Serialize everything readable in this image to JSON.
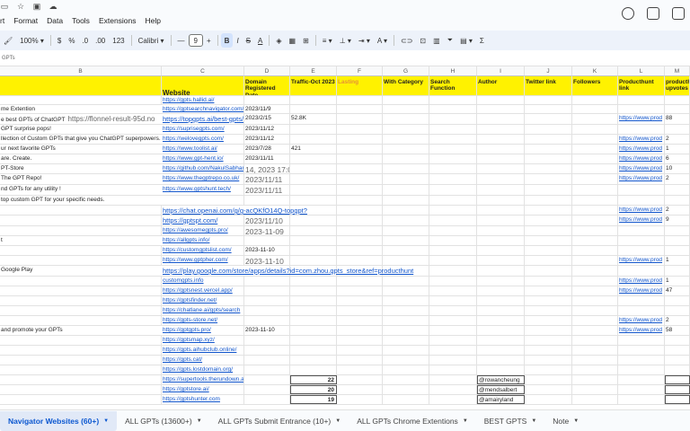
{
  "menu": {
    "items": [
      "rt",
      "Format",
      "Data",
      "Tools",
      "Extensions",
      "Help"
    ]
  },
  "toolbar": {
    "zoom": "100%",
    "currency": "$",
    "percent": "%",
    "decimal_decrease": ".0",
    "decimal_increase": ".00",
    "number_format": "123",
    "font": "Calibri",
    "font_size": "9"
  },
  "formula_bar": {
    "name_box": "GPTs"
  },
  "columns": [
    "B",
    "C",
    "D",
    "E",
    "F",
    "G",
    "H",
    "I",
    "J",
    "K",
    "L",
    "M"
  ],
  "header_row": {
    "B": "",
    "C": "Website",
    "D": "Domain Registered Date",
    "E": "Traffic-Oct 2023",
    "F": "Lasting",
    "G": "With Category",
    "H": "Search Function",
    "I": "Author",
    "J": "Twitter link",
    "K": "Followers",
    "L": "Producthunt link",
    "M": "producthunt upvotes"
  },
  "rows": [
    {
      "B": "",
      "C": "https://gpts.hallid.ai/",
      "D": "",
      "E": "",
      "I": "",
      "L": "",
      "M": ""
    },
    {
      "B": "me Extention",
      "C": "https://gptsearchnavigator.com/",
      "D": "2023/11/9",
      "E": "",
      "I": "",
      "L": "",
      "M": ""
    },
    {
      "B": "e best GPTs of ChatGPT",
      "B2": "https://flonnel-result-95d.no",
      "C": "https://topgpts.ai/best-gpts/",
      "D": "2023/2/15",
      "E": "52.8K",
      "I": "",
      "L": "https://www.prod",
      "M": "88"
    },
    {
      "B": "GPT surprise pops!",
      "C": "https://suprisegpts.com/",
      "D": "2023/11/12",
      "E": "",
      "I": "",
      "L": "",
      "M": ""
    },
    {
      "B": "llection of Custom GPTs that give you ChatGPT superpowers.",
      "C": "https://welovegpts.com/",
      "D": "2023/11/12",
      "E": "",
      "I": "",
      "L": "https://www.prod",
      "M": "2"
    },
    {
      "B": "ur next favorite GPTs",
      "C": "https://www.toolist.ai/",
      "D": "2023/7/28",
      "E": "421",
      "I": "",
      "L": "https://www.prod",
      "M": "1"
    },
    {
      "B": "are. Create.",
      "C": "https://www.gpt-hent.io/",
      "D": "2023/11/11",
      "E": "",
      "I": "",
      "L": "https://www.prod",
      "M": "6"
    },
    {
      "B": "PT-Store",
      "C": "https://github.com/NakulSabhar",
      "D": "14, 2023 17:01",
      "E": "",
      "I": "",
      "L": "https://www.prod",
      "M": "10"
    },
    {
      "B": "The GPT Repo!",
      "C": "https://www.thegptrepo.co.uk/",
      "D": "2023/11/11",
      "E": "",
      "I": "",
      "L": "https://www.prod",
      "M": "2"
    },
    {
      "B": "nd GPTs for any utility !",
      "C": "https://www.gptshunt.tech/",
      "D": "2023/11/11",
      "E": "",
      "I": "",
      "L": "",
      "M": ""
    },
    {
      "B": "top custom GPT for your specific needs.",
      "C": "",
      "D": "",
      "E": "",
      "I": "",
      "L": "",
      "M": ""
    },
    {
      "B": "",
      "C": "https://chat.openai.com/g/g-acQKfO14Q-topgpt?",
      "D": "",
      "E": "",
      "I": "",
      "L": "https://www.prod",
      "M": "2"
    },
    {
      "B": "",
      "C": "https://gptspt.com/",
      "D": "2023/11/10",
      "E": "",
      "I": "",
      "L": "https://www.prod",
      "M": "9"
    },
    {
      "B": "",
      "C": "https://awesomegpts.pro/",
      "D": "2023-11-09",
      "E": "",
      "I": "",
      "L": "",
      "M": ""
    },
    {
      "B": "t",
      "C": "https://allgpts.info/",
      "D": "",
      "E": "",
      "I": "",
      "L": "",
      "M": ""
    },
    {
      "B": "",
      "C": "https://customgptslist.com/",
      "D": "2023-11-10",
      "E": "",
      "I": "",
      "L": "",
      "M": ""
    },
    {
      "B": "",
      "C": "https://www.gptpher.com/",
      "D": "2023-11-10",
      "E": "",
      "I": "",
      "L": "https://www.prod",
      "M": "1"
    },
    {
      "B": "Google Play",
      "C": "https://play.google.com/store/apps/details?id=com.zhou.gpts_store&ref=producthunt",
      "D": "",
      "E": "",
      "I": "",
      "L": "",
      "M": ""
    },
    {
      "B": "",
      "C": "customgpts.info",
      "D": "",
      "E": "",
      "I": "",
      "L": "https://www.prod",
      "M": "1"
    },
    {
      "B": "",
      "C": "https://gptsnest.vercel.app/",
      "D": "",
      "E": "",
      "I": "",
      "L": "https://www.prod",
      "M": "47"
    },
    {
      "B": "",
      "C": "https://gptsfinder.net/",
      "D": "",
      "E": "",
      "I": "",
      "L": "",
      "M": ""
    },
    {
      "B": "",
      "C": "https://chatlane.ai/gpts/search",
      "D": "",
      "E": "",
      "I": "",
      "L": "",
      "M": ""
    },
    {
      "B": "",
      "C": "https://gpts-store.net/",
      "D": "",
      "E": "",
      "I": "",
      "L": "https://www.prod",
      "M": "2"
    },
    {
      "B": "and promote your GPTs",
      "C": "https://gptgpts.pro/",
      "D": "2023-11-10",
      "E": "",
      "I": "",
      "L": "https://www.prod",
      "M": "58"
    },
    {
      "B": "",
      "C": "https://gptsmap.xyz/",
      "D": "",
      "E": "",
      "I": "",
      "L": "",
      "M": ""
    },
    {
      "B": "",
      "C": "https://gpts.aihubclub.online/",
      "D": "",
      "E": "",
      "I": "",
      "L": "",
      "M": ""
    },
    {
      "B": "",
      "C": "https://gpts.cat/",
      "D": "",
      "E": "",
      "I": "",
      "L": "",
      "M": ""
    },
    {
      "B": "",
      "C": "https://gpts.lostdomain.org/",
      "D": "",
      "E": "",
      "I": "",
      "L": "",
      "M": ""
    },
    {
      "B": "",
      "C": "https://supertools.therundown.ai/gpts",
      "D": "",
      "E": "22",
      "I": "@rowancheung",
      "L": "",
      "M": ""
    },
    {
      "B": "",
      "C": "https://gptstore.ai/",
      "D": "",
      "E": "20",
      "I": "@mendsalbert",
      "L": "",
      "M": ""
    },
    {
      "B": "",
      "C": "https://gptshunter.com",
      "D": "",
      "E": "19",
      "I": "@amairyland",
      "L": "",
      "M": ""
    }
  ],
  "tabs": [
    {
      "label": "Navigator Websites (60+)",
      "active": true
    },
    {
      "label": "ALL GPTs (13600+)",
      "active": false
    },
    {
      "label": "ALL GPTs Submit Entrance (10+)",
      "active": false
    },
    {
      "label": "ALL GPTs Chrome Extentions",
      "active": false
    },
    {
      "label": "BEST GPTS",
      "active": false
    },
    {
      "label": "Note",
      "active": false
    }
  ],
  "colors": {
    "header_fill": "#fff200",
    "link": "#1155cc",
    "active_tab": "#0b57d0"
  }
}
